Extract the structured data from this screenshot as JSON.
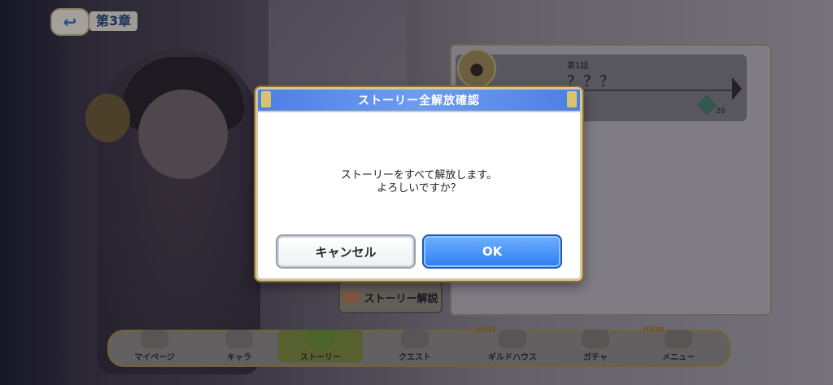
{
  "header": {
    "back_icon": "back-arrow-icon",
    "chapter_label": "第3章"
  },
  "story_panel": {
    "story_number": "第1話",
    "story_title": "？？？",
    "gem_count": "20",
    "lock_icon": "lock-icon",
    "gem_icon": "gem-icon"
  },
  "story_explain_button": {
    "label": "ストーリー解説",
    "icon": "book-icon"
  },
  "bottom_nav": {
    "items": [
      {
        "label": "マイページ",
        "icon": "home-icon"
      },
      {
        "label": "キャラ",
        "icon": "character-icon"
      },
      {
        "label": "ストーリー",
        "icon": "story-icon"
      },
      {
        "label": "クエスト",
        "icon": "sword-icon"
      },
      {
        "label": "ギルドハウス",
        "icon": "house-icon"
      },
      {
        "label": "ガチャ",
        "icon": "gacha-icon"
      },
      {
        "label": "メニュー",
        "icon": "crystal-icon"
      }
    ],
    "new_badges": [
      "NEW",
      "NEW"
    ]
  },
  "dialog": {
    "title": "ストーリー全解放確認",
    "message_line1": "ストーリーをすべて解放します。",
    "message_line2": "よろしいですか？",
    "cancel_label": "キャンセル",
    "ok_label": "OK",
    "colors": {
      "header": "#4d7fe4",
      "ok_button": "#2d7df0",
      "border_gold": "#d2c79e"
    }
  }
}
